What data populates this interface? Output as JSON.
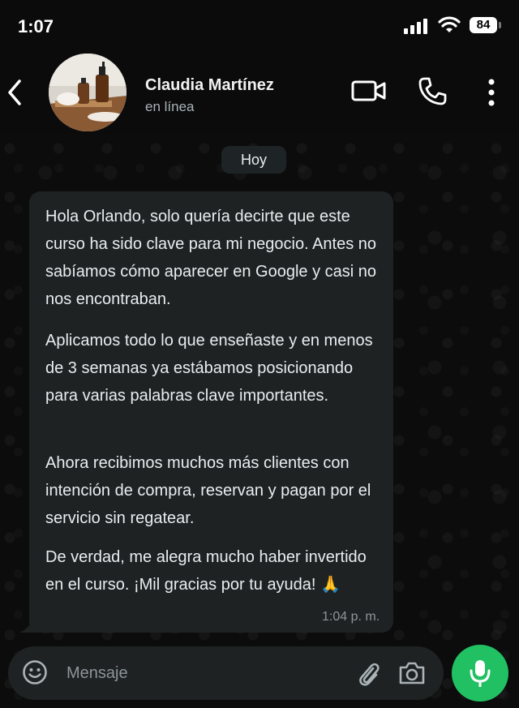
{
  "status_bar": {
    "time": "1:07",
    "battery": "84"
  },
  "header": {
    "name": "Claudia Martínez",
    "status": "en línea",
    "icons": [
      "back-arrow-icon",
      "video-camera-icon",
      "phone-icon",
      "more-vertical-icon"
    ]
  },
  "date_chip": "Hoy",
  "message": {
    "paragraphs": [
      "Hola Orlando, solo quería decirte que este curso ha sido clave para mi negocio. Antes no sabíamos cómo aparecer en Google y casi no nos encontraban.",
      "Aplicamos todo lo que enseñaste y en menos de 3 semanas ya estábamos posicionando para varias palabras clave importantes.",
      "Ahora recibimos muchos más clientes con intención de compra, reservan y pagan por el servicio sin regatear.",
      "De verdad, me alegra mucho haber invertido en el curso. ¡Mil gracias por tu ayuda!"
    ],
    "emoji": "🙏",
    "time": "1:04 p. m."
  },
  "composer": {
    "placeholder": "Mensaje",
    "icons": [
      "emoji-icon",
      "attach-icon",
      "camera-icon",
      "mic-icon"
    ]
  },
  "colors": {
    "background": "#0b0b0b",
    "bubble": "#1f2223",
    "mic_button": "#21c063",
    "text": "#e9edef",
    "secondary_text": "#8c9598"
  }
}
